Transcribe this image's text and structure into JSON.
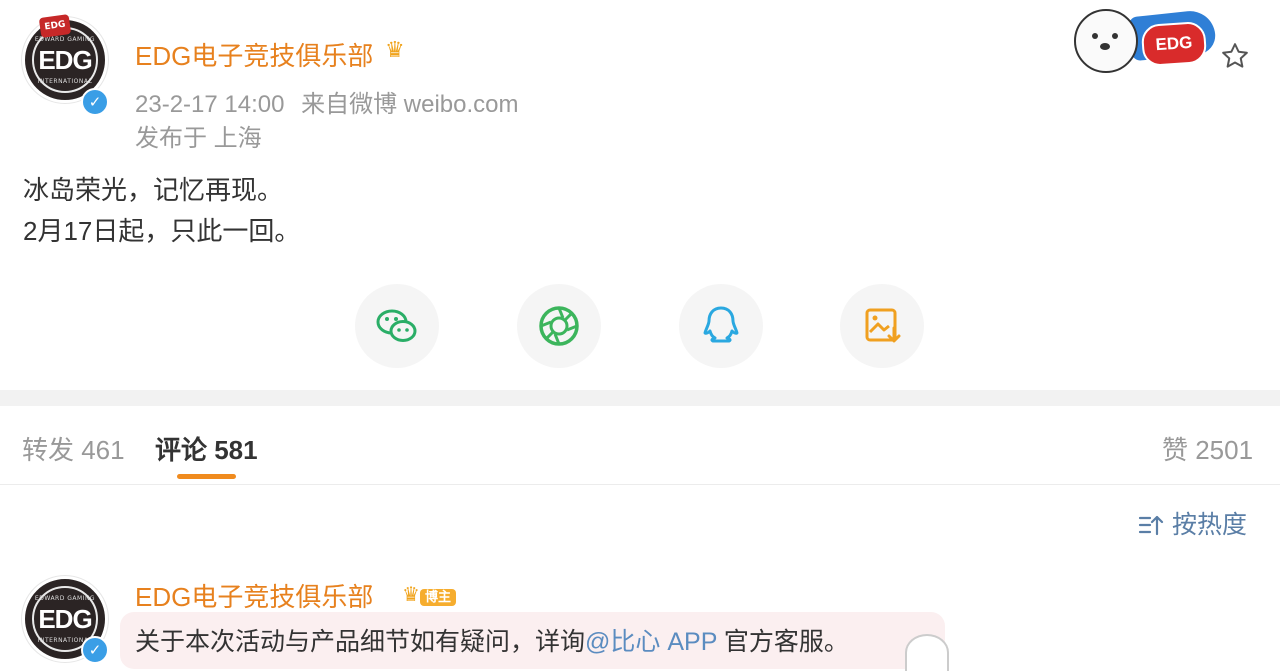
{
  "post": {
    "author": "EDG电子竞技俱乐部",
    "avatar_logo": "EDG",
    "avatar_top_text": "EDWARD GAMING",
    "avatar_bottom_text": "INTERNATIONAL",
    "timestamp": "23-2-17 14:00",
    "source": "来自微博 weibo.com",
    "location": "发布于 上海",
    "content_line1": "冰岛荣光，记忆再现。",
    "content_line2": "2月17日起，只此一回。",
    "sticker_text": "EDG"
  },
  "share_buttons": [
    {
      "name": "wechat-icon",
      "color": "#2aae67"
    },
    {
      "name": "moments-icon",
      "color": "#3cb55c"
    },
    {
      "name": "qq-icon",
      "color": "#2aa8e0"
    },
    {
      "name": "save-image-icon",
      "color": "#f0a020"
    }
  ],
  "tabs": {
    "repost": "转发 461",
    "comments": "评论 581",
    "likes": "赞 2501"
  },
  "sort": {
    "label": "按热度"
  },
  "comment": {
    "author": "EDG电子竞技俱乐部",
    "badge": "博主",
    "text_before": "关于本次活动与产品细节如有疑问，详询",
    "mention": "@比心 APP",
    "text_after": "官方客服。"
  },
  "colors": {
    "accent": "#e7811e",
    "link": "#5b8cc0",
    "verified": "#3a9ee6"
  }
}
